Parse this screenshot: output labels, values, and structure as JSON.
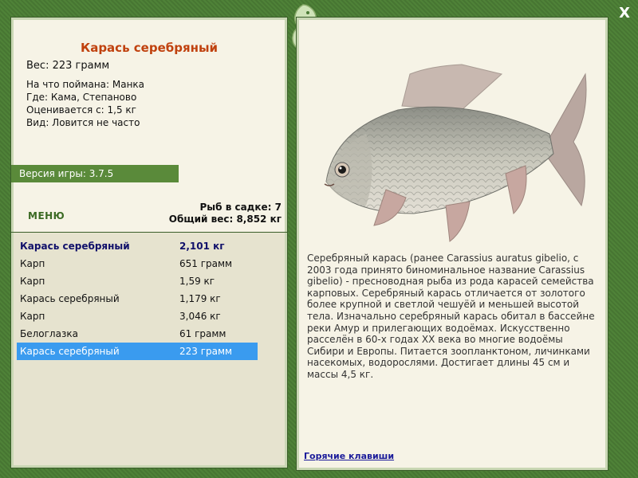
{
  "fish": {
    "name": "Карась серебряный",
    "weight_line": "Вес: 223 грамм",
    "info": [
      "На что поймана: Манка",
      "Где: Кама, Степаново",
      "Оценивается с: 1,5 кг",
      "Вид: Ловится не часто"
    ]
  },
  "version": "Версия игры: 3.7.5",
  "menu_label": "МЕНЮ",
  "keepnet": {
    "count_line": "Рыб в садке: 7",
    "total_line": "Общий вес: 8,852 кг"
  },
  "catch_list": [
    {
      "name": "Карась серебряный",
      "weight": "2,101 кг"
    },
    {
      "name": "Карп",
      "weight": "651 грамм"
    },
    {
      "name": "Карп",
      "weight": "1,59 кг"
    },
    {
      "name": "Карась серебряный",
      "weight": "1,179 кг"
    },
    {
      "name": "Карп",
      "weight": "3,046 кг"
    },
    {
      "name": "Белоглазка",
      "weight": "61 грамм"
    },
    {
      "name": "Карась серебряный",
      "weight": "223 грамм"
    }
  ],
  "description": "Серебряный карась (ранее Carassius auratus gibelio, с 2003 года принято биноминальное название Carassius gibelio) - пресноводная рыба из рода карасей семейства карповых. Серебряный карась отличается от золотого более крупной и светлой чешуёй и меньшей высотой тела. Изначально серебряный карась обитал в бассейне реки Амур и прилегающих водоёмах. Искусственно расселён в 60-х годах XX века во многие водоёмы Сибири и Европы. Питается зоопланктоном, личинками насекомых, водорослями. Достигает длины 45 см и массы 4,5 кг.",
  "hotkeys_label": "Горячие клавиши",
  "close_label": "X",
  "colors": {
    "title": "#c0410e",
    "accent_green": "#5a8a3a",
    "selection": "#3a9bef",
    "link": "#1b1b9a"
  }
}
